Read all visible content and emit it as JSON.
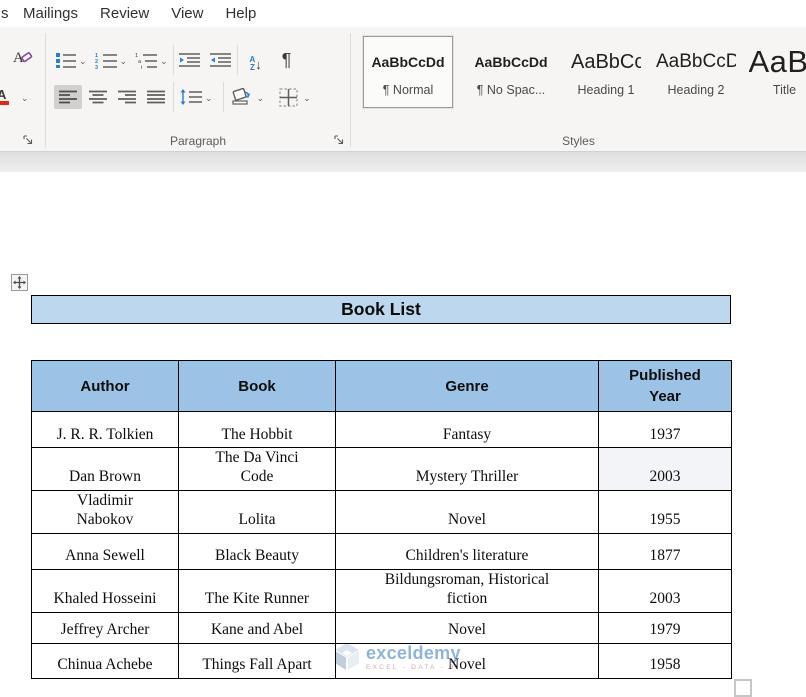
{
  "ribbon": {
    "tabs": [
      {
        "label": "s"
      },
      {
        "label": "Mailings"
      },
      {
        "label": "Review"
      },
      {
        "label": "View"
      },
      {
        "label": "Help"
      }
    ],
    "paragraph_group_label": "Paragraph",
    "styles_group_label": "Styles",
    "pilcrow": "¶",
    "sort_a": "A",
    "sort_z": "Z",
    "sort_arrow": "↓",
    "chevron": "⌄",
    "styles_gallery": [
      {
        "preview": "AaBbCcDd",
        "label": "¶ Normal",
        "selected": true
      },
      {
        "preview": "AaBbCcDd",
        "label": "¶ No Spac..."
      },
      {
        "preview": "AaBbCcDd",
        "label": "Heading 1"
      },
      {
        "preview": "AaBbCcDd",
        "label": "Heading 2"
      },
      {
        "preview": "AaB",
        "label": "Title"
      }
    ],
    "colors": {
      "accent_blue": "#2B7CD3",
      "heading1_blue": "#2E74B5",
      "heading2_blue": "#5B9BD5"
    }
  },
  "document": {
    "title": "Book List",
    "table": {
      "headers": [
        "Author",
        "Book",
        "Genre",
        "Published\nYear"
      ],
      "rows": [
        {
          "author": "J. R. R. Tolkien",
          "book": "The Hobbit",
          "genre": "Fantasy",
          "year": "1937",
          "year_shaded": false
        },
        {
          "author": "Dan Brown",
          "book": "The Da Vinci\nCode",
          "genre": "Mystery Thriller",
          "year": "2003",
          "year_shaded": true
        },
        {
          "author": "Vladimir\nNabokov",
          "book": "Lolita",
          "genre": "Novel",
          "year": "1955",
          "year_shaded": false
        },
        {
          "author": "Anna Sewell",
          "book": "Black Beauty",
          "genre": "Children's literature",
          "year": "1877",
          "year_shaded": false
        },
        {
          "author": "Khaled Hosseini",
          "book": "The Kite Runner",
          "genre": "Bildungsroman, Historical\nfiction",
          "year": "2003",
          "year_shaded": false
        },
        {
          "author": "Jeffrey Archer",
          "book": "Kane and Abel",
          "genre": "Novel",
          "year": "1979",
          "year_shaded": false
        },
        {
          "author": "Chinua Achebe",
          "book": "Things Fall Apart",
          "genre": "Novel",
          "year": "1958",
          "year_shaded": false
        }
      ],
      "header_fill": "#9CC3E6",
      "title_fill": "#BDD7EE",
      "shaded_cell_fill": "#F2F4F7"
    },
    "watermark": {
      "name": "exceldemy",
      "tagline": "EXCEL - DATA - BI"
    }
  }
}
